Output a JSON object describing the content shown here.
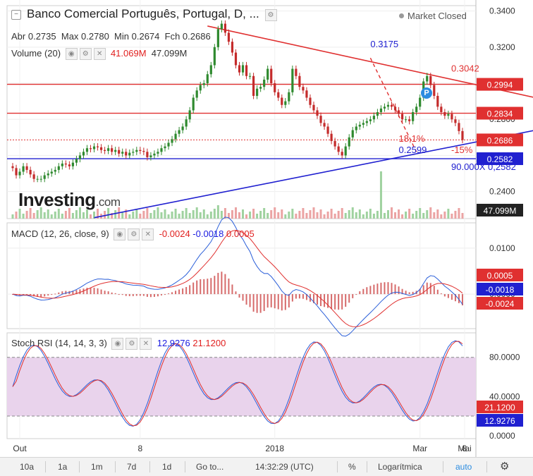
{
  "header": {
    "title": "Banco Comercial Português, Portugal, D, ...",
    "market_status": "Market Closed",
    "ohlc": {
      "open_label": "Abr",
      "open": "0.2735",
      "high_label": "Max",
      "high": "0.2780",
      "low_label": "Min",
      "low": "0.2674",
      "close_label": "Fch",
      "close": "0.2686"
    },
    "volume_label": "Volume (20)",
    "volume_value_1": "41.069M",
    "volume_value_2": "47.099M",
    "macd_label": "MACD (12, 26, close, 9)",
    "macd_values": [
      "-0.0024",
      "-0.0018",
      "0.0005"
    ],
    "rsi_label": "Stoch RSI (14, 14, 3, 3)",
    "rsi_values": [
      "12.9276",
      "21.1200"
    ],
    "logo": "Investing",
    "logo_suffix": ".com"
  },
  "toolbar": {
    "ranges": [
      "10a",
      "1a",
      "1m",
      "7d",
      "1d"
    ],
    "goto": "Go to...",
    "time": "14:32:29 (UTC)",
    "percent": "%",
    "log": "Logarítmica",
    "auto": "auto",
    "settings_icon": "gear-icon"
  },
  "colors": {
    "up": "#2f8a2f",
    "down": "#c42b2b",
    "red_line": "#e03030",
    "blue_line": "#2020d0",
    "rsi_band": "#e9d3ec",
    "macd_line": "#2b5fd9",
    "signal_line": "#e0302f"
  },
  "chart_data": {
    "type": "candlestick",
    "x_ticks": [
      "Out",
      "8",
      "2018",
      "Mar",
      "Mai",
      "8"
    ],
    "price_axis": {
      "ticks": [
        "0.3400",
        "0.3200",
        "0.3000",
        "0.2800",
        "0.2600",
        "0.2400"
      ],
      "range": [
        0.225,
        0.343
      ]
    },
    "price_labels": [
      {
        "value": "0.2994",
        "color": "#e03030"
      },
      {
        "value": "0.2834",
        "color": "#e03030"
      },
      {
        "value": "0.2686",
        "color": "#e03030"
      },
      {
        "value": "0.2582",
        "color": "#2020d0"
      },
      {
        "value": "47.099M",
        "color": "#222222"
      }
    ],
    "horizontal_lines": [
      {
        "value": 0.2994,
        "color": "#e03030",
        "style": "solid"
      },
      {
        "value": 0.2834,
        "color": "#e03030",
        "style": "solid"
      },
      {
        "value": 0.2686,
        "color": "#e03030",
        "style": "dotted"
      },
      {
        "value": 0.2582,
        "color": "#2020d0",
        "style": "solid"
      }
    ],
    "trendlines": [
      {
        "from": [
          55,
          0.3317
        ],
        "to": [
          163,
          0.2854
        ],
        "color": "#e03030"
      },
      {
        "from": [
          23,
          0.2255
        ],
        "to": [
          163,
          0.28
        ],
        "color": "#2020d0"
      }
    ],
    "annotations": [
      {
        "text": "0.3175",
        "color": "#2020d0",
        "x": 101,
        "y": 0.32
      },
      {
        "text": "0.3042",
        "color": "#e03030",
        "x": 149,
        "y": 0.3065
      },
      {
        "text": "18,1%",
        "color": "#e03030",
        "x": 109,
        "y": 0.2675
      },
      {
        "text": "0.2599",
        "color": "#2020d0",
        "x": 109,
        "y": 0.2614
      },
      {
        "text": "-15%",
        "color": "#e03030",
        "x": 153,
        "y": 0.2614
      },
      {
        "text": "90.000X 0,2582",
        "color": "#2020d0",
        "x": 140,
        "y": 0.252
      }
    ],
    "candles_close": [
      0.253,
      0.249,
      0.251,
      0.254,
      0.252,
      0.2495,
      0.247,
      0.247,
      0.247,
      0.249,
      0.25,
      0.251,
      0.252,
      0.254,
      0.2555,
      0.255,
      0.254,
      0.256,
      0.258,
      0.26,
      0.262,
      0.264,
      0.2635,
      0.265,
      0.2645,
      0.263,
      0.2625,
      0.264,
      0.262,
      0.263,
      0.261,
      0.262,
      0.26,
      0.2615,
      0.262,
      0.263,
      0.2625,
      0.262,
      0.259,
      0.26,
      0.261,
      0.262,
      0.264,
      0.265,
      0.267,
      0.269,
      0.272,
      0.274,
      0.276,
      0.28,
      0.285,
      0.292,
      0.296,
      0.299,
      0.3,
      0.305,
      0.31,
      0.32,
      0.33,
      0.333,
      0.328,
      0.323,
      0.317,
      0.31,
      0.306,
      0.31,
      0.304,
      0.304,
      0.293,
      0.297,
      0.298,
      0.302,
      0.308,
      0.3,
      0.295,
      0.292,
      0.288,
      0.29,
      0.295,
      0.308,
      0.304,
      0.298,
      0.296,
      0.292,
      0.288,
      0.285,
      0.282,
      0.278,
      0.276,
      0.272,
      0.268,
      0.265,
      0.262,
      0.26,
      0.265,
      0.27,
      0.274,
      0.276,
      0.277,
      0.278,
      0.279,
      0.28,
      0.282,
      0.284,
      0.286,
      0.287,
      0.288,
      0.287,
      0.285,
      0.283,
      0.28,
      0.28,
      0.279,
      0.284,
      0.287,
      0.292,
      0.301,
      0.304,
      0.299,
      0.293,
      0.287,
      0.284,
      0.282,
      0.283,
      0.28,
      0.278,
      0.2735,
      0.2686
    ],
    "volume_last": "47.099M",
    "macd": {
      "axis_ticks": [
        "0.0100",
        "0.0000"
      ],
      "range": [
        -0.0075,
        0.0155
      ],
      "value_labels": [
        {
          "value": "0.0005",
          "color": "#e03030"
        },
        {
          "value": "-0.0018",
          "color": "#2020d0"
        },
        {
          "value": "-0.0024",
          "color": "#e03030"
        }
      ]
    },
    "stoch_rsi": {
      "axis_ticks": [
        "80.0000",
        "40.0000",
        "0.0000"
      ],
      "range": [
        -3,
        105
      ],
      "band": [
        20,
        80
      ],
      "value_labels": [
        {
          "value": "21.1200",
          "color": "#e03030"
        },
        {
          "value": "12.9276",
          "color": "#2020d0"
        }
      ]
    }
  }
}
